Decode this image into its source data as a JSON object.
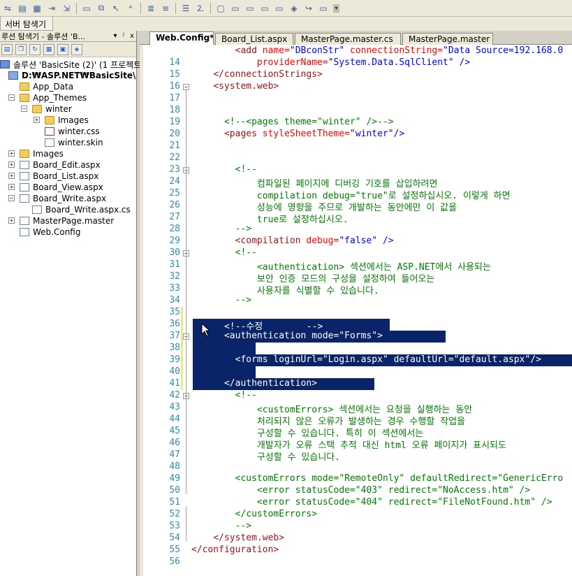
{
  "server_tab": {
    "label": "서버 탐색기"
  },
  "solution_explorer": {
    "title": "루션 탐색기 - 솔루션 'B...",
    "pin": "ᴶ",
    "close": "x",
    "tree": [
      {
        "label": "솔루션 'BasicSite (2)' (1 프로젝트)",
        "icon": "solution-icon"
      },
      {
        "label": "D:₩ASP.NET₩BasicSite\\",
        "icon": "project-icon"
      },
      {
        "label": "App_Data",
        "icon": "folder-icon"
      },
      {
        "label": "App_Themes",
        "icon": "folder-icon"
      },
      {
        "label": "winter",
        "icon": "folder-icon"
      },
      {
        "label": "Images",
        "icon": "folder-icon"
      },
      {
        "label": "winter.css",
        "icon": "css-file-icon"
      },
      {
        "label": "winter.skin",
        "icon": "skin-file-icon"
      },
      {
        "label": "Images",
        "icon": "folder-icon"
      },
      {
        "label": "Board_Edit.aspx",
        "icon": "aspx-file-icon"
      },
      {
        "label": "Board_List.aspx",
        "icon": "aspx-file-icon"
      },
      {
        "label": "Board_View.aspx",
        "icon": "aspx-file-icon"
      },
      {
        "label": "Board_Write.aspx",
        "icon": "aspx-file-icon"
      },
      {
        "label": "Board_Write.aspx.cs",
        "icon": "cs-file-icon"
      },
      {
        "label": "MasterPage.master",
        "icon": "master-file-icon"
      },
      {
        "label": "Web.Config",
        "icon": "config-file-icon"
      }
    ]
  },
  "editor_tabs": [
    "Web.Config*",
    "Board_List.aspx",
    "MasterPage.master.cs",
    "MasterPage.master"
  ],
  "lines": [
    {
      "n": "",
      "segs": [
        [
          "        ",
          "#000"
        ],
        [
          "<add ",
          "#a31515"
        ],
        [
          "name=",
          "#ff0000"
        ],
        [
          "\"DBconStr\" ",
          "#0000ff"
        ],
        [
          "connectionString=",
          "#ff0000"
        ],
        [
          "\"Data Source=192.168.0",
          "#0000ff"
        ]
      ]
    },
    {
      "n": "14",
      "segs": [
        [
          "            ",
          "#000"
        ],
        [
          "providerName=",
          "#ff0000"
        ],
        [
          "\"System.Data.SqlClient\" ",
          "#0000ff"
        ],
        [
          "/>",
          "#0000ff"
        ]
      ]
    },
    {
      "n": "15",
      "segs": [
        [
          "    ",
          "#000"
        ],
        [
          "</connectionStrings>",
          "#a31515"
        ]
      ]
    },
    {
      "n": "16",
      "segs": [
        [
          "    ",
          "#000"
        ],
        [
          "<system.web>",
          "#a31515"
        ]
      ]
    },
    {
      "n": "17",
      "segs": []
    },
    {
      "n": "18",
      "segs": []
    },
    {
      "n": "19",
      "segs": [
        [
          "      ",
          "#000"
        ],
        [
          "<!--<pages theme=\"winter\" />-->",
          "#008000"
        ]
      ]
    },
    {
      "n": "20",
      "segs": [
        [
          "      ",
          "#000"
        ],
        [
          "<pages ",
          "#a31515"
        ],
        [
          "styleSheetTheme=",
          "#ff0000"
        ],
        [
          "\"winter\"",
          "#0000ff"
        ],
        [
          "/>",
          "#0000ff"
        ]
      ]
    },
    {
      "n": "21",
      "segs": []
    },
    {
      "n": "22",
      "segs": []
    },
    {
      "n": "23",
      "segs": [
        [
          "        ",
          "#000"
        ],
        [
          "<!--",
          "#008000"
        ]
      ]
    },
    {
      "n": "24",
      "segs": [
        [
          "            ",
          "#000"
        ],
        [
          "컴파일된 페이지에 디버깅 기호를 삽입하려면",
          "#008000"
        ]
      ]
    },
    {
      "n": "25",
      "segs": [
        [
          "            ",
          "#000"
        ],
        [
          "compilation debug=\"true\"로 설정하십시오. 이렇게 하면",
          "#008000"
        ]
      ]
    },
    {
      "n": "26",
      "segs": [
        [
          "            ",
          "#000"
        ],
        [
          "성능에 영향을 주므로 개발하는 동안에만 이 값을",
          "#008000"
        ]
      ]
    },
    {
      "n": "27",
      "segs": [
        [
          "            ",
          "#000"
        ],
        [
          "true로 설정하십시오.",
          "#008000"
        ]
      ]
    },
    {
      "n": "28",
      "segs": [
        [
          "        ",
          "#000"
        ],
        [
          "-->",
          "#008000"
        ]
      ]
    },
    {
      "n": "29",
      "segs": [
        [
          "        ",
          "#000"
        ],
        [
          "<compilation ",
          "#a31515"
        ],
        [
          "debug=",
          "#ff0000"
        ],
        [
          "\"false\" ",
          "#0000ff"
        ],
        [
          "/>",
          "#0000ff"
        ]
      ]
    },
    {
      "n": "30",
      "segs": [
        [
          "        ",
          "#000"
        ],
        [
          "<!--",
          "#008000"
        ]
      ]
    },
    {
      "n": "31",
      "segs": [
        [
          "            ",
          "#000"
        ],
        [
          "<authentication> 섹션에서는 ASP.NET에서 사용되는",
          "#008000"
        ]
      ]
    },
    {
      "n": "32",
      "segs": [
        [
          "            ",
          "#000"
        ],
        [
          "보안 인증 모드의 구성을 설정하여 들어오는",
          "#008000"
        ]
      ]
    },
    {
      "n": "33",
      "segs": [
        [
          "            ",
          "#000"
        ],
        [
          "사용자를 식별할 수 있습니다.",
          "#008000"
        ]
      ]
    },
    {
      "n": "34",
      "segs": [
        [
          "        ",
          "#000"
        ],
        [
          "-->",
          "#008000"
        ]
      ]
    },
    {
      "n": "35",
      "segs": []
    },
    {
      "n": "36",
      "segs": [
        [
          "      ",
          "#fff"
        ],
        [
          "<!--수정        -->",
          "#fff"
        ]
      ]
    },
    {
      "n": "37",
      "segs": [
        [
          "      ",
          "#fff"
        ],
        [
          "<authentication mode=\"Forms\">",
          "#fff"
        ]
      ]
    },
    {
      "n": "38",
      "segs": []
    },
    {
      "n": "39",
      "segs": [
        [
          "        ",
          "#fff"
        ],
        [
          "<forms loginUrl=\"Login.aspx\" defaultUrl=\"default.aspx\"/>",
          "#fff"
        ]
      ]
    },
    {
      "n": "40",
      "segs": []
    },
    {
      "n": "41",
      "segs": [
        [
          "      ",
          "#fff"
        ],
        [
          "</authentication>",
          "#fff"
        ]
      ]
    },
    {
      "n": "42",
      "segs": [
        [
          "        ",
          "#000"
        ],
        [
          "<!--",
          "#008000"
        ]
      ]
    },
    {
      "n": "43",
      "segs": [
        [
          "            ",
          "#000"
        ],
        [
          "<customErrors> 섹션에서는 요청을 실행하는 동안",
          "#008000"
        ]
      ]
    },
    {
      "n": "44",
      "segs": [
        [
          "            ",
          "#000"
        ],
        [
          "처리되지 않은 오류가 발생하는 경우 수행할 작업을",
          "#008000"
        ]
      ]
    },
    {
      "n": "45",
      "segs": [
        [
          "            ",
          "#000"
        ],
        [
          "구성할 수 있습니다. 특히 이 섹션에서는",
          "#008000"
        ]
      ]
    },
    {
      "n": "46",
      "segs": [
        [
          "            ",
          "#000"
        ],
        [
          "개발자가 오류 스택 추적 대신 html 오류 페이지가 표시되도",
          "#008000"
        ]
      ]
    },
    {
      "n": "47",
      "segs": [
        [
          "            ",
          "#000"
        ],
        [
          "구성할 수 있습니다.",
          "#008000"
        ]
      ]
    },
    {
      "n": "48",
      "segs": []
    },
    {
      "n": "49",
      "segs": [
        [
          "        ",
          "#000"
        ],
        [
          "<customErrors mode=\"RemoteOnly\" defaultRedirect=\"GenericErro",
          "#008000"
        ]
      ]
    },
    {
      "n": "50",
      "segs": [
        [
          "            ",
          "#000"
        ],
        [
          "<error statusCode=\"403\" redirect=\"NoAccess.htm\" />",
          "#008000"
        ]
      ]
    },
    {
      "n": "51",
      "segs": [
        [
          "            ",
          "#000"
        ],
        [
          "<error statusCode=\"404\" redirect=\"FileNotFound.htm\" />",
          "#008000"
        ]
      ]
    },
    {
      "n": "52",
      "segs": [
        [
          "        ",
          "#000"
        ],
        [
          "</customErrors>",
          "#008000"
        ]
      ]
    },
    {
      "n": "53",
      "segs": [
        [
          "        ",
          "#000"
        ],
        [
          "-->",
          "#008000"
        ]
      ]
    },
    {
      "n": "54",
      "segs": [
        [
          "    ",
          "#000"
        ],
        [
          "</system.web>",
          "#a31515"
        ]
      ]
    },
    {
      "n": "55",
      "segs": [
        [
          "",
          "#000"
        ],
        [
          "</configuration>",
          "#a31515"
        ]
      ]
    },
    {
      "n": "56",
      "segs": []
    }
  ],
  "toolbar_icons": [
    "format-icon",
    "page-icon",
    "table-icon",
    "step-icon",
    "nav-icon",
    "window-icon",
    "layers-icon",
    "pointer-icon",
    "font-icon",
    "indent-icon",
    "outdent-icon",
    "list-icon",
    "list-num-icon",
    "box-icon",
    "comment-icon",
    "comment2-icon",
    "comment3-icon",
    "comment4-icon",
    "comment5-icon",
    "comment6-icon",
    "comment7-icon"
  ]
}
